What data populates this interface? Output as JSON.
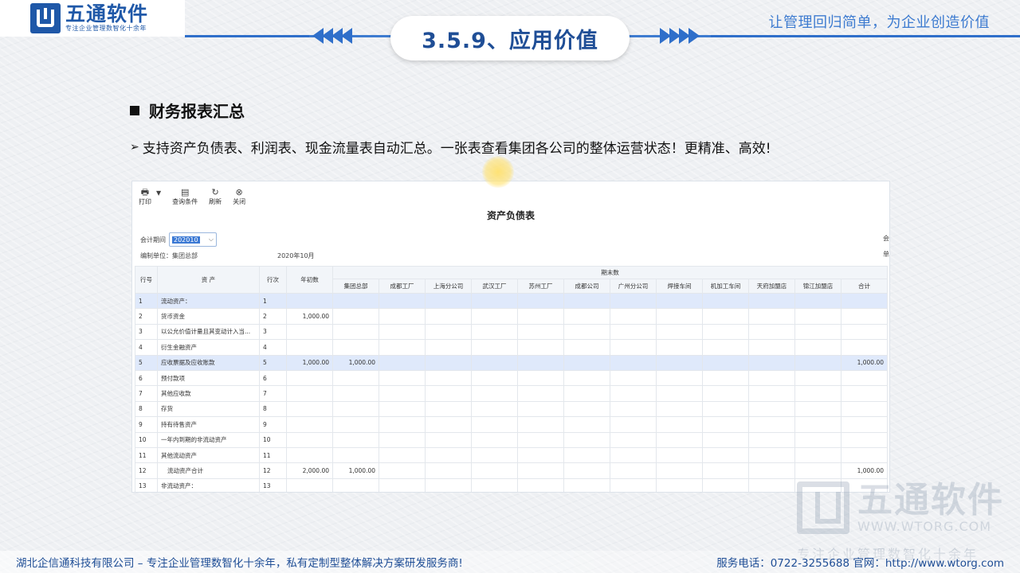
{
  "header": {
    "logo_name": "五通软件",
    "logo_sub": "专注企业管理数智化十余年",
    "title": "3.5.9、应用价值",
    "slogan": "让管理回归简单，为企业创造价值"
  },
  "section": {
    "title": "财务报表汇总",
    "description": "支持资产负债表、利润表、现金流量表自动汇总。一张表查看集团各公司的整体运营状态！更精准、高效!"
  },
  "app": {
    "toolbar": [
      {
        "label": "打印",
        "icon": "printer-icon"
      },
      {
        "label": "查询条件",
        "icon": "filter-icon"
      },
      {
        "label": "刷新",
        "icon": "refresh-icon"
      },
      {
        "label": "关闭",
        "icon": "close-icon"
      }
    ],
    "report_title": "资产负债表",
    "period_label": "会计期间",
    "period_value": "202010",
    "unit_label": "编制单位：集团总部",
    "date_label": "2020年10月",
    "right_stub_1": "会",
    "right_stub_2": "单",
    "columns": {
      "row_no": "行号",
      "asset": "资 产",
      "line_no": "行次",
      "begin": "年初数",
      "end_group": "期末数",
      "companies": [
        "集团总部",
        "成都工厂",
        "上海分公司",
        "武汉工厂",
        "苏州工厂",
        "成都公司",
        "广州分公司",
        "焊接车间",
        "机加工车间",
        "天府加盟店",
        "锦江加盟店",
        "合计"
      ]
    },
    "rows": [
      {
        "no": "1",
        "name": "流动资产：",
        "line": "1",
        "begin": "",
        "hq": "",
        "total": "",
        "hl": true
      },
      {
        "no": "2",
        "name": "货币资金",
        "line": "2",
        "begin": "1,000.00",
        "hq": "",
        "total": "",
        "hl": false
      },
      {
        "no": "3",
        "name": "以公允价值计量且其变动计入当...",
        "line": "3",
        "begin": "",
        "hq": "",
        "total": "",
        "hl": false
      },
      {
        "no": "4",
        "name": "衍生金融资产",
        "line": "4",
        "begin": "",
        "hq": "",
        "total": "",
        "hl": false
      },
      {
        "no": "5",
        "name": "应收票据及应收账款",
        "line": "5",
        "begin": "1,000.00",
        "hq": "1,000.00",
        "total": "1,000.00",
        "hl": true
      },
      {
        "no": "6",
        "name": "预付款项",
        "line": "6",
        "begin": "",
        "hq": "",
        "total": "",
        "hl": false
      },
      {
        "no": "7",
        "name": "其他应收款",
        "line": "7",
        "begin": "",
        "hq": "",
        "total": "",
        "hl": false
      },
      {
        "no": "8",
        "name": "存货",
        "line": "8",
        "begin": "",
        "hq": "",
        "total": "",
        "hl": false
      },
      {
        "no": "9",
        "name": "持有待售资产",
        "line": "9",
        "begin": "",
        "hq": "",
        "total": "",
        "hl": false
      },
      {
        "no": "10",
        "name": "一年内到期的非流动资产",
        "line": "10",
        "begin": "",
        "hq": "",
        "total": "",
        "hl": false
      },
      {
        "no": "11",
        "name": "其他流动资产",
        "line": "11",
        "begin": "",
        "hq": "",
        "total": "",
        "hl": false
      },
      {
        "no": "12",
        "name": "流动资产合计",
        "line": "12",
        "begin": "2,000.00",
        "hq": "1,000.00",
        "total": "1,000.00",
        "hl": false
      },
      {
        "no": "13",
        "name": "非流动资产：",
        "line": "13",
        "begin": "",
        "hq": "",
        "total": "",
        "hl": false
      }
    ]
  },
  "watermark": {
    "name": "五通软件",
    "url": "WWW.WTORG.COM",
    "sub": "专注企业管理数智化十余年"
  },
  "footer": {
    "left": "湖北企信通科技有限公司 – 专注企业管理数智化十余年，私有定制型整体解决方案研发服务商!",
    "right": "服务电话：0722-3255688  官网：http://www.wtorg.com"
  }
}
